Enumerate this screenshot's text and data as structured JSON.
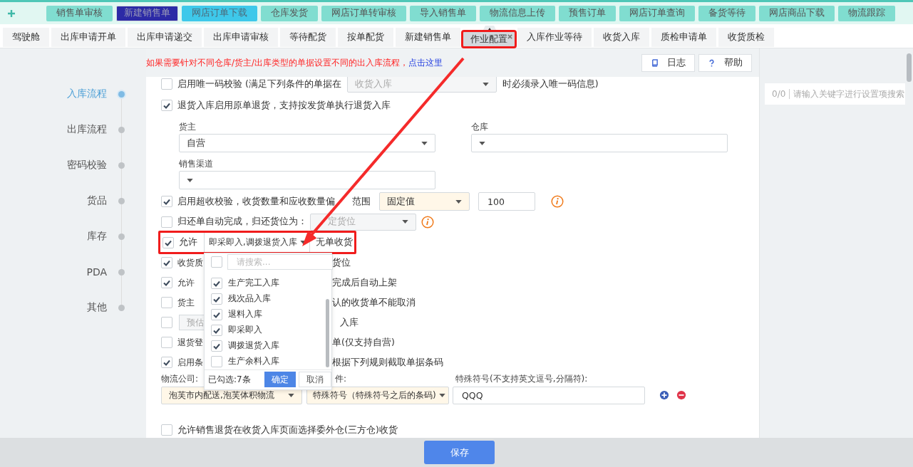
{
  "top_nav": {
    "items": [
      {
        "label": "销售单审核",
        "selected": false,
        "hovered": false
      },
      {
        "label": "新建销售单",
        "selected": true,
        "hovered": false
      },
      {
        "label": "网店订单下载",
        "selected": false,
        "hovered": true
      },
      {
        "label": "仓库发货",
        "selected": false,
        "hovered": false
      },
      {
        "label": "网店订单转审核",
        "selected": false,
        "hovered": false
      },
      {
        "label": "导入销售单",
        "selected": false,
        "hovered": false
      },
      {
        "label": "物流信息上传",
        "selected": false,
        "hovered": false
      },
      {
        "label": "预售订单",
        "selected": false,
        "hovered": false
      },
      {
        "label": "网店订单查询",
        "selected": false,
        "hovered": false
      },
      {
        "label": "备货等待",
        "selected": false,
        "hovered": false
      },
      {
        "label": "网店商品下载",
        "selected": false,
        "hovered": false
      },
      {
        "label": "物流跟踪",
        "selected": false,
        "hovered": false
      }
    ]
  },
  "tabs": [
    {
      "label": "驾驶舱",
      "selected": false,
      "closable": false,
      "highlighted": false
    },
    {
      "label": "出库申请开单",
      "selected": false,
      "closable": false,
      "highlighted": false
    },
    {
      "label": "出库申请递交",
      "selected": false,
      "closable": false,
      "highlighted": false
    },
    {
      "label": "出库申请审核",
      "selected": false,
      "closable": false,
      "highlighted": false
    },
    {
      "label": "等待配货",
      "selected": false,
      "closable": false,
      "highlighted": false
    },
    {
      "label": "按单配货",
      "selected": false,
      "closable": false,
      "highlighted": false
    },
    {
      "label": "新建销售单",
      "selected": false,
      "closable": false,
      "highlighted": false
    },
    {
      "label": "作业配置",
      "selected": true,
      "closable": true,
      "highlighted": true
    },
    {
      "label": "入库作业等待",
      "selected": false,
      "closable": false,
      "highlighted": false
    },
    {
      "label": "收货入库",
      "selected": false,
      "closable": false,
      "highlighted": false
    },
    {
      "label": "质检申请单",
      "selected": false,
      "closable": false,
      "highlighted": false
    },
    {
      "label": "收货质检",
      "selected": false,
      "closable": false,
      "highlighted": false
    }
  ],
  "sidebar": {
    "items": [
      {
        "label": "入库流程",
        "selected": true
      },
      {
        "label": "出库流程",
        "selected": false
      },
      {
        "label": "密码校验",
        "selected": false
      },
      {
        "label": "货品",
        "selected": false
      },
      {
        "label": "库存",
        "selected": false
      },
      {
        "label": "PDA",
        "selected": false
      },
      {
        "label": "其他",
        "selected": false
      }
    ]
  },
  "notice": {
    "text": "如果需要针对不同仓库/货主/出库类型的单据设置不同的出入库流程，",
    "link": "点击这里"
  },
  "toolbar": [
    {
      "label": "日志",
      "kind": "log"
    },
    {
      "label": "帮助",
      "kind": "help"
    }
  ],
  "search": {
    "count": "0/0",
    "placeholder": "请输入关键字进行设置项搜索"
  },
  "settings": [
    {
      "kind": "check_select",
      "checked": false,
      "label": "启用唯一码校验 (满足下列条件的单据在",
      "select": {
        "value": "收货入库",
        "disabled": true
      },
      "suffix": "时必须录入唯一码信息)"
    },
    {
      "kind": "check",
      "checked": true,
      "label": "退货入库启用原单退货，支持按发货单执行退货入库"
    },
    {
      "kind": "fields",
      "fields": [
        {
          "label": "货主",
          "value": "自营"
        },
        {
          "label": "仓库"
        }
      ]
    },
    {
      "kind": "fields",
      "fields": [
        {
          "label": "销售渠道"
        }
      ]
    },
    {
      "kind": "check_select_input",
      "checked": true,
      "label": "启用超收校验，收货数量和应收数量偏",
      "label_rest": "范围",
      "select": {
        "value": "固定值",
        "disabled": false
      },
      "input": "100",
      "info": true
    },
    {
      "kind": "check_select",
      "checked": false,
      "label": "归还单自动完成，归还货位为：",
      "select": {
        "value": "定货位",
        "disabled": true
      },
      "info": true
    },
    {
      "kind": "check_dropdown",
      "checked": true,
      "label": "允许",
      "select": {
        "value": "即采即入,调拨退货入库"
      },
      "suffix": "无单收货",
      "highlighted": true,
      "dropdown": {
        "search_placeholder": "请搜索...",
        "search_checked": false,
        "options": [
          {
            "label": "生产完工入库",
            "checked": true
          },
          {
            "label": "残次品入库",
            "checked": true
          },
          {
            "label": "退料入库",
            "checked": true
          },
          {
            "label": "即采即入",
            "checked": true
          },
          {
            "label": "调拨退货入库",
            "checked": true
          },
          {
            "label": "生产余料入库",
            "checked": false
          }
        ],
        "count": "已勾选:7条",
        "confirm": "确定",
        "cancel": "取消"
      }
    },
    {
      "kind": "partial",
      "checked": true,
      "label": "收货质",
      "tail": "货位"
    },
    {
      "kind": "partial",
      "checked": true,
      "label": "允许",
      "tail": "完成后自动上架"
    },
    {
      "kind": "partial",
      "checked": false,
      "label": "货主",
      "tail": "认的收货单不能取消"
    },
    {
      "kind": "partial_input",
      "checked": false,
      "placeholder": "预估",
      "tail": "入库"
    },
    {
      "kind": "partial",
      "checked": false,
      "label": "退货登",
      "tail": "单(仅支持自营)"
    },
    {
      "kind": "partial",
      "checked": true,
      "label": "启用条",
      "tail": "根据下列规则截取单据条码"
    },
    {
      "kind": "rule",
      "labels": [
        "物流公司:",
        "件:",
        "特殊符号(不支持英文逗号,分隔符):"
      ],
      "company": "泡芙市内配送,泡芙体积物流",
      "condition": "特殊符号（特殊符号之后的条码)",
      "symbol": "QQQ"
    },
    {
      "kind": "check",
      "checked": false,
      "label": "允许销售退货在收货入库页面选择委外仓(三方仓)收货"
    }
  ],
  "save_button": {
    "label": "保存"
  }
}
